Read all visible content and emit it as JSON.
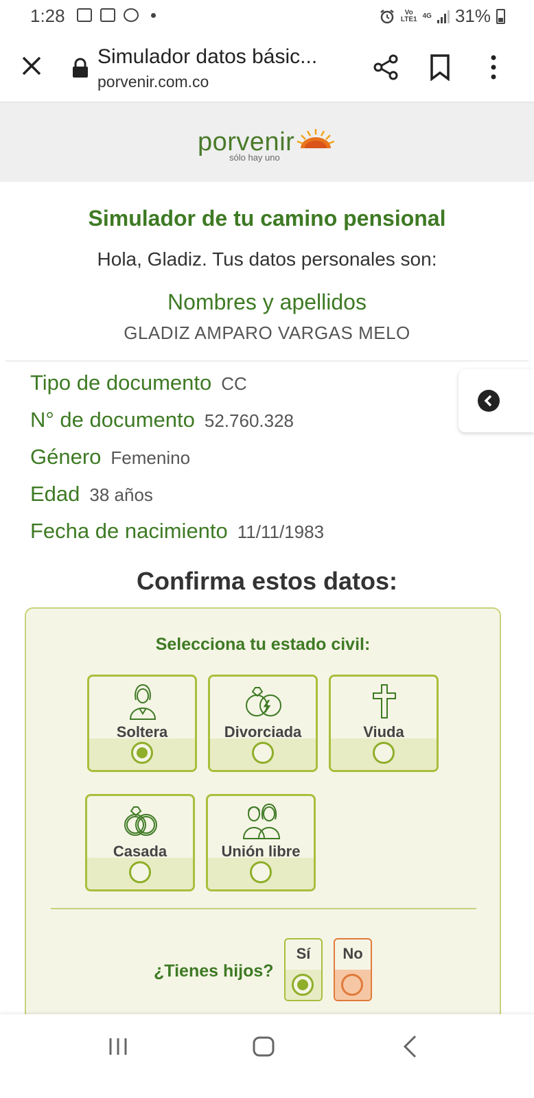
{
  "status_bar": {
    "time": "1:28",
    "battery": "31%",
    "network_top": "Vo",
    "network_bottom": "LTE1",
    "network_type": "4G",
    "icons": [
      "image-icon",
      "news-icon",
      "chrome-icon",
      "alarm-icon",
      "signal-icon",
      "battery-icon"
    ]
  },
  "browser": {
    "title": "Simulador datos básic...",
    "url": "porvenir.com.co"
  },
  "brand": {
    "name": "porvenir",
    "tagline": "sólo hay uno"
  },
  "page": {
    "title": "Simulador de tu camino pensional",
    "greeting": "Hola, Gladiz. Tus datos personales son:",
    "name_label": "Nombres y apellidos",
    "name_value": "GLADIZ AMPARO VARGAS MELO"
  },
  "details": [
    {
      "label": "Tipo de documento",
      "value": "CC"
    },
    {
      "label": "N° de documento",
      "value": "52.760.328"
    },
    {
      "label": "Género",
      "value": "Femenino"
    },
    {
      "label": "Edad",
      "value": "38 años"
    },
    {
      "label": "Fecha de nacimiento",
      "value": "11/11/1983"
    }
  ],
  "confirm": {
    "heading": "Confirma estos datos:",
    "civil_title": "Selecciona tu estado civil:",
    "options": [
      {
        "label": "Soltera",
        "icon": "woman-icon",
        "selected": true
      },
      {
        "label": "Divorciada",
        "icon": "broken-rings-icon",
        "selected": false
      },
      {
        "label": "Viuda",
        "icon": "cross-icon",
        "selected": false
      },
      {
        "label": "Casada",
        "icon": "rings-icon",
        "selected": false
      },
      {
        "label": "Unión libre",
        "icon": "couple-icon",
        "selected": false
      }
    ],
    "kids_question": "¿Tienes hijos?",
    "yes_label": "Sí",
    "no_label": "No"
  },
  "colors": {
    "brand_green": "#3e7a24",
    "option_border": "#a8bf3c",
    "panel_bg": "#f5f5e6",
    "no_accent": "#e07a3a"
  }
}
